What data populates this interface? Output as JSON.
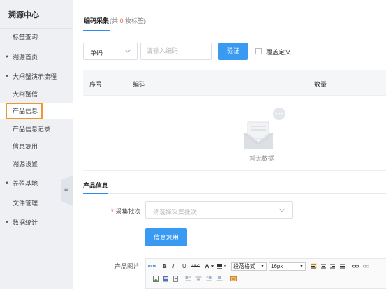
{
  "sidebar": {
    "title": "溯源中心",
    "items": [
      {
        "label": "标签查询",
        "caret": ""
      },
      {
        "label": "溯源首页",
        "caret": "▼"
      },
      {
        "label": "大闸蟹演示流程",
        "caret": "▼"
      },
      {
        "label": "大闸蟹信",
        "caret": ""
      },
      {
        "label": "产品信息",
        "caret": ""
      },
      {
        "label": "产品信息记录",
        "caret": ""
      },
      {
        "label": "信息复用",
        "caret": ""
      },
      {
        "label": "溯源设置",
        "caret": ""
      },
      {
        "label": "养殖基地",
        "caret": "▼"
      },
      {
        "label": "文件管理",
        "caret": ""
      },
      {
        "label": "数据统计",
        "caret": "▼"
      }
    ],
    "collapse_icon": "≡"
  },
  "tabs": {
    "active": "编码采集",
    "count_prefix": "(共",
    "count": "0",
    "count_suffix": "枚标签)"
  },
  "filter": {
    "type_value": "单码",
    "code_placeholder": "请输入编码",
    "verify_label": "验证",
    "override_label": "覆盖定义",
    "override_checked": false
  },
  "table": {
    "headers": [
      "序号",
      "编码",
      "数量"
    ],
    "empty_text": "暂无数据"
  },
  "product": {
    "section_title": "产品信息",
    "batch_label": "采集批次",
    "batch_placeholder": "请选择采集批次",
    "reuse_label": "信息复用",
    "image_label": "产品图片"
  },
  "editor": {
    "html_label": "HTML",
    "bold": "B",
    "italic": "I",
    "underline": "U",
    "strike": "ABC",
    "format_value": "段落格式",
    "size_value": "16px"
  },
  "colors": {
    "primary": "#3a9af2",
    "highlight_box": "#f0962c",
    "count_number": "#f05a28",
    "required": "#f0433c"
  }
}
